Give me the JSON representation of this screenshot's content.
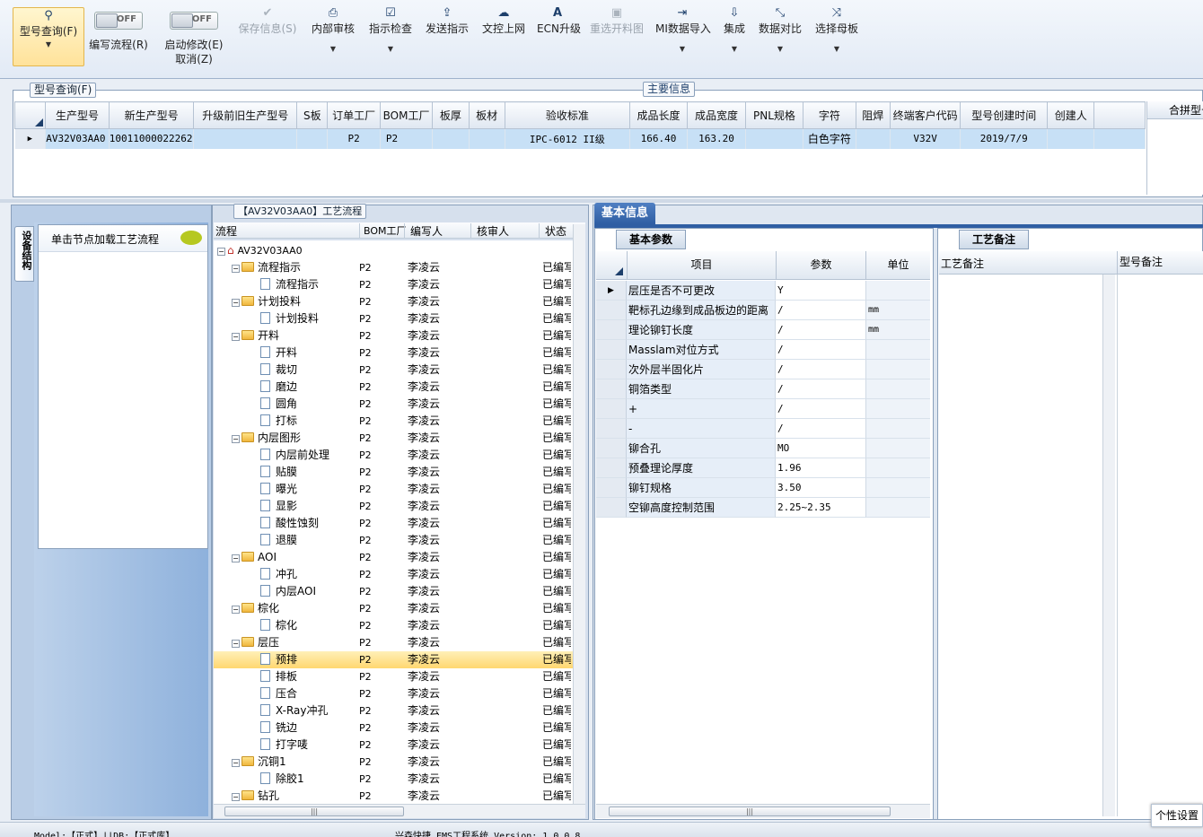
{
  "toolbar": {
    "items": [
      {
        "id": "query",
        "label": "型号查询(F)",
        "icon": "search-icon",
        "dropdown": true
      },
      {
        "id": "edit_flow",
        "label": "编写流程(R)",
        "toggle": "OFF"
      },
      {
        "id": "start_modify",
        "label": "启动修改(E)",
        "label2": "取消(Z)",
        "toggle": "OFF"
      },
      {
        "id": "save",
        "label": "保存信息(S)",
        "icon": "check-icon",
        "disabled": true
      },
      {
        "id": "internal_review",
        "label": "内部审核",
        "icon": "printer-icon",
        "dropdown": true
      },
      {
        "id": "instruction_check",
        "label": "指示检查",
        "icon": "checkbox-icon",
        "dropdown": true
      },
      {
        "id": "send_instruction",
        "label": "发送指示",
        "icon": "upload-icon"
      },
      {
        "id": "doc_control",
        "label": "文控上网",
        "icon": "cloud-upload-icon"
      },
      {
        "id": "ecn",
        "label": "ECN升级",
        "icon": "font-a-icon"
      },
      {
        "id": "reselect_image",
        "label": "重选开料图",
        "icon": "image-icon",
        "disabled": true
      },
      {
        "id": "mi_import",
        "label": "MI数据导入",
        "icon": "import-icon",
        "dropdown": true
      },
      {
        "id": "integrate",
        "label": "集成",
        "icon": "download-icon",
        "dropdown": true
      },
      {
        "id": "compare",
        "label": "数据对比",
        "icon": "compress-icon",
        "dropdown": true
      },
      {
        "id": "select_master",
        "label": "选择母板",
        "icon": "shuffle-icon",
        "dropdown": true
      }
    ]
  },
  "query_group": {
    "title": "型号查询(F)",
    "main_info_tab": "主要信息",
    "side_col": "合拼型号"
  },
  "main_grid": {
    "columns": [
      "生产型号",
      "新生产型号",
      "升级前旧生产型号",
      "S板",
      "订单工厂",
      "BOM工厂",
      "板厚",
      "板材",
      "验收标准",
      "成品长度",
      "成品宽度",
      "PNL规格",
      "字符",
      "阻焊",
      "终端客户代码",
      "型号创建时间",
      "创建人"
    ],
    "row": [
      "AV32V03AA0",
      "10011000022262",
      "",
      "",
      "P2",
      "P2",
      "",
      "",
      "IPC-6012 II级",
      "166.40",
      "163.20",
      "",
      "白色字符",
      "",
      "V32V",
      "2019/7/9",
      ""
    ]
  },
  "left_panel": {
    "vtab": "设备结构",
    "hint": "单击节点加载工艺流程"
  },
  "flow_panel": {
    "title": "【AV32V03AA0】工艺流程",
    "columns": [
      "流程",
      "BOM工厂",
      "编写人",
      "核审人",
      "状态"
    ],
    "root": "AV32V03AA0",
    "nodes": [
      {
        "name": "流程指示",
        "level": 1,
        "bom": "P2",
        "writer": "李凌云",
        "status": "已编写"
      },
      {
        "name": "流程指示",
        "level": 2,
        "bom": "P2",
        "writer": "李凌云",
        "status": "已编写"
      },
      {
        "name": "计划投料",
        "level": 1,
        "bom": "P2",
        "writer": "李凌云",
        "status": "已编写"
      },
      {
        "name": "计划投料",
        "level": 2,
        "bom": "P2",
        "writer": "李凌云",
        "status": "已编写"
      },
      {
        "name": "开料",
        "level": 1,
        "bom": "P2",
        "writer": "李凌云",
        "status": "已编写"
      },
      {
        "name": "开料",
        "level": 2,
        "bom": "P2",
        "writer": "李凌云",
        "status": "已编写"
      },
      {
        "name": "裁切",
        "level": 2,
        "bom": "P2",
        "writer": "李凌云",
        "status": "已编写"
      },
      {
        "name": "磨边",
        "level": 2,
        "bom": "P2",
        "writer": "李凌云",
        "status": "已编写"
      },
      {
        "name": "圆角",
        "level": 2,
        "bom": "P2",
        "writer": "李凌云",
        "status": "已编写"
      },
      {
        "name": "打标",
        "level": 2,
        "bom": "P2",
        "writer": "李凌云",
        "status": "已编写"
      },
      {
        "name": "内层图形",
        "level": 1,
        "bom": "P2",
        "writer": "李凌云",
        "status": "已编写"
      },
      {
        "name": "内层前处理",
        "level": 2,
        "bom": "P2",
        "writer": "李凌云",
        "status": "已编写"
      },
      {
        "name": "贴膜",
        "level": 2,
        "bom": "P2",
        "writer": "李凌云",
        "status": "已编写"
      },
      {
        "name": "曝光",
        "level": 2,
        "bom": "P2",
        "writer": "李凌云",
        "status": "已编写"
      },
      {
        "name": "显影",
        "level": 2,
        "bom": "P2",
        "writer": "李凌云",
        "status": "已编写"
      },
      {
        "name": "酸性蚀刻",
        "level": 2,
        "bom": "P2",
        "writer": "李凌云",
        "status": "已编写"
      },
      {
        "name": "退膜",
        "level": 2,
        "bom": "P2",
        "writer": "李凌云",
        "status": "已编写"
      },
      {
        "name": "AOI",
        "level": 1,
        "bom": "P2",
        "writer": "李凌云",
        "status": "已编写"
      },
      {
        "name": "冲孔",
        "level": 2,
        "bom": "P2",
        "writer": "李凌云",
        "status": "已编写"
      },
      {
        "name": "内层AOI",
        "level": 2,
        "bom": "P2",
        "writer": "李凌云",
        "status": "已编写"
      },
      {
        "name": "棕化",
        "level": 1,
        "bom": "P2",
        "writer": "李凌云",
        "status": "已编写"
      },
      {
        "name": "棕化",
        "level": 2,
        "bom": "P2",
        "writer": "李凌云",
        "status": "已编写"
      },
      {
        "name": "层压",
        "level": 1,
        "bom": "P2",
        "writer": "李凌云",
        "status": "已编写"
      },
      {
        "name": "预排",
        "level": 2,
        "bom": "P2",
        "writer": "李凌云",
        "status": "已编写",
        "selected": true
      },
      {
        "name": "排板",
        "level": 2,
        "bom": "P2",
        "writer": "李凌云",
        "status": "已编写"
      },
      {
        "name": "压合",
        "level": 2,
        "bom": "P2",
        "writer": "李凌云",
        "status": "已编写"
      },
      {
        "name": "X-Ray冲孔",
        "level": 2,
        "bom": "P2",
        "writer": "李凌云",
        "status": "已编写"
      },
      {
        "name": "铣边",
        "level": 2,
        "bom": "P2",
        "writer": "李凌云",
        "status": "已编写"
      },
      {
        "name": "打字唛",
        "level": 2,
        "bom": "P2",
        "writer": "李凌云",
        "status": "已编写"
      },
      {
        "name": "沉铜1",
        "level": 1,
        "bom": "P2",
        "writer": "李凌云",
        "status": "已编写"
      },
      {
        "name": "除胶1",
        "level": 2,
        "bom": "P2",
        "writer": "李凌云",
        "status": "已编写"
      },
      {
        "name": "钻孔",
        "level": 1,
        "bom": "P2",
        "writer": "李凌云",
        "status": "已编写"
      }
    ]
  },
  "basic_info": {
    "tab": "基本信息",
    "subtab": "基本参数",
    "columns": [
      "项目",
      "参数",
      "单位"
    ],
    "rows": [
      {
        "k": "层压是否不可更改",
        "v": "Y",
        "u": ""
      },
      {
        "k": "靶标孔边缘到成品板边的距离",
        "v": "/",
        "u": "mm"
      },
      {
        "k": "理论铆钉长度",
        "v": "/",
        "u": "mm"
      },
      {
        "k": "Masslam对位方式",
        "v": "/",
        "u": ""
      },
      {
        "k": "次外层半固化片",
        "v": "/",
        "u": ""
      },
      {
        "k": "铜箔类型",
        "v": "/",
        "u": ""
      },
      {
        "k": "+",
        "v": "/",
        "u": ""
      },
      {
        "k": "-",
        "v": "/",
        "u": ""
      },
      {
        "k": "铆合孔",
        "v": "MO",
        "u": ""
      },
      {
        "k": "预叠理论厚度",
        "v": "1.96",
        "u": ""
      },
      {
        "k": "铆钉规格",
        "v": "3.50",
        "u": ""
      },
      {
        "k": "空铆高度控制范围",
        "v": "2.25~2.35",
        "u": ""
      }
    ]
  },
  "notes": {
    "tab": "工艺备注",
    "col1": "工艺备注",
    "col2": "型号备注"
  },
  "status_bar": {
    "left": "Model:【正式】||DB:【正式库】",
    "center": "兴森快捷 EMS工程系统 Version: 1.0.0.8",
    "popup": "个性设置"
  }
}
